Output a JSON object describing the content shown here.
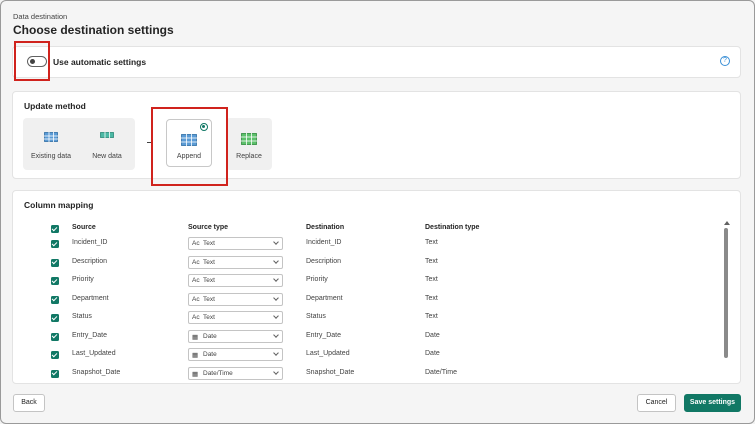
{
  "header": {
    "breadcrumb": "Data destination",
    "title": "Choose destination settings"
  },
  "auto_settings": {
    "label": "Use automatic settings",
    "enabled": false,
    "help_icon": "question-circle-icon"
  },
  "update_method": {
    "title": "Update method",
    "options": [
      {
        "label": "Existing data",
        "icon": "table-icon",
        "selected": false
      },
      {
        "label": "New data",
        "icon": "table-row-icon",
        "selected": false
      },
      {
        "label": "Append",
        "icon": "table-append-icon",
        "selected": true
      },
      {
        "label": "Replace",
        "icon": "table-replace-icon",
        "selected": false
      }
    ]
  },
  "column_mapping": {
    "title": "Column mapping",
    "headers": {
      "source": "Source",
      "source_type": "Source type",
      "destination": "Destination",
      "destination_type": "Destination type"
    },
    "rows": [
      {
        "source": "Incident_ID",
        "type_icon": "A​c",
        "source_type": "Text",
        "destination": "Incident_ID",
        "destination_type": "Text"
      },
      {
        "source": "Description",
        "type_icon": "A​c",
        "source_type": "Text",
        "destination": "Description",
        "destination_type": "Text"
      },
      {
        "source": "Priority",
        "type_icon": "A​c",
        "source_type": "Text",
        "destination": "Priority",
        "destination_type": "Text"
      },
      {
        "source": "Department",
        "type_icon": "A​c",
        "source_type": "Text",
        "destination": "Department",
        "destination_type": "Text"
      },
      {
        "source": "Status",
        "type_icon": "A​c",
        "source_type": "Text",
        "destination": "Status",
        "destination_type": "Text"
      },
      {
        "source": "Entry_Date",
        "type_icon": "▦",
        "source_type": "Date",
        "destination": "Entry_Date",
        "destination_type": "Date"
      },
      {
        "source": "Last_Updated",
        "type_icon": "▦",
        "source_type": "Date",
        "destination": "Last_Updated",
        "destination_type": "Date"
      },
      {
        "source": "Snapshot_Date",
        "type_icon": "▦",
        "source_type": "Date/Time",
        "destination": "Snapshot_Date",
        "destination_type": "Date/Time"
      }
    ]
  },
  "footer": {
    "back": "Back",
    "cancel": "Cancel",
    "save": "Save settings"
  },
  "colors": {
    "accent": "#117865",
    "highlight": "#d0231d"
  }
}
